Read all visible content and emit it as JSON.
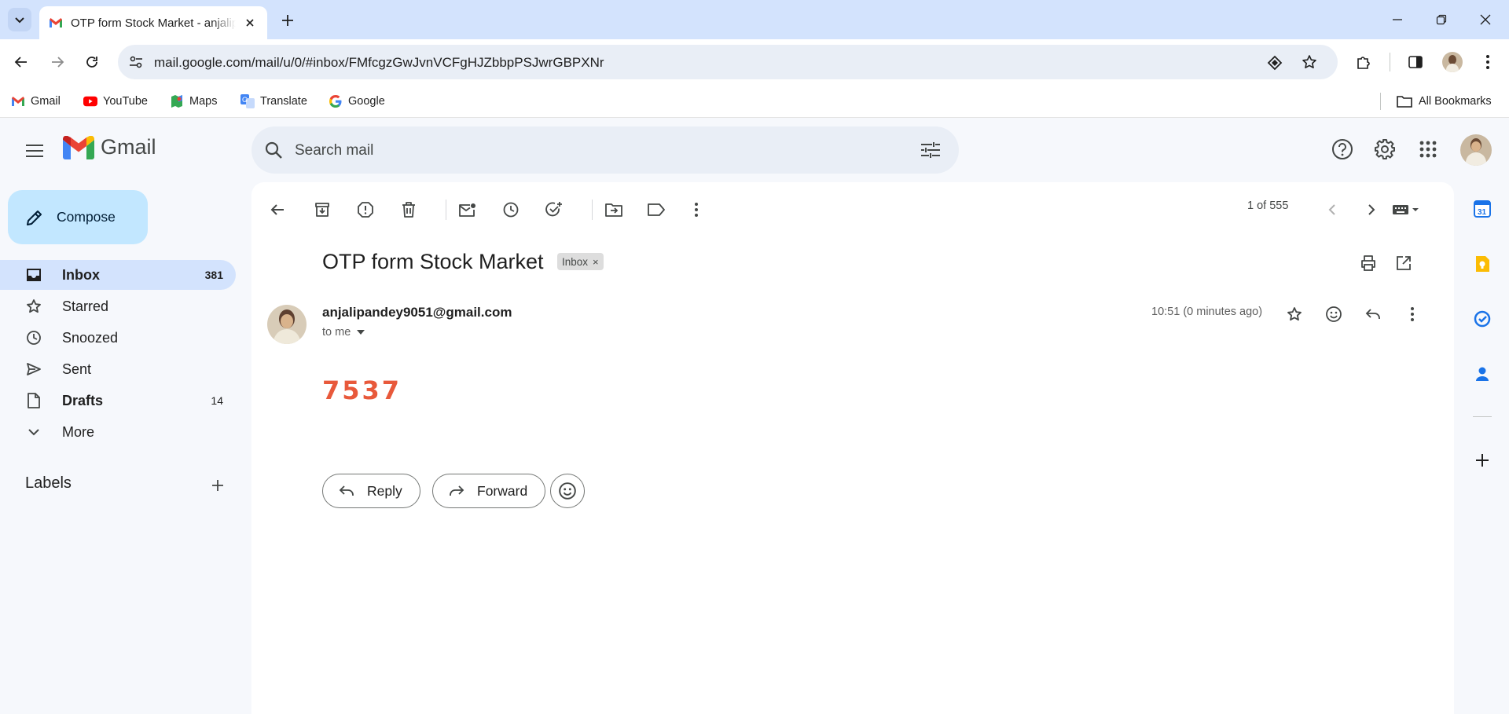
{
  "browser": {
    "tab_title": "OTP form Stock Market - anjalipandey9051@gmail.com - Gmail",
    "url": "mail.google.com/mail/u/0/#inbox/FMfcgzGwJvnVCFgHJZbbpPSJwrGBPXNr",
    "bookmarks": [
      "Gmail",
      "YouTube",
      "Maps",
      "Translate",
      "Google"
    ],
    "all_bookmarks": "All Bookmarks"
  },
  "gmail": {
    "brand": "Gmail",
    "search_placeholder": "Search mail",
    "compose": "Compose",
    "nav": [
      {
        "label": "Inbox",
        "count": "381",
        "icon": "inbox-icon"
      },
      {
        "label": "Starred",
        "count": "",
        "icon": "star-icon"
      },
      {
        "label": "Snoozed",
        "count": "",
        "icon": "clock-icon"
      },
      {
        "label": "Sent",
        "count": "",
        "icon": "send-icon"
      },
      {
        "label": "Drafts",
        "count": "14",
        "icon": "draft-icon"
      },
      {
        "label": "More",
        "count": "",
        "icon": "chevron-down-icon"
      }
    ],
    "labels_heading": "Labels"
  },
  "message": {
    "pager": "1 of 555",
    "subject": "OTP form Stock Market",
    "label_chip": "Inbox",
    "sender": "anjalipandey9051@gmail.com",
    "to": "to me",
    "time": "10:51 (0 minutes ago)",
    "body_code": "7537",
    "reply": "Reply",
    "forward": "Forward"
  },
  "colors": {
    "accent": "#d3e3fd",
    "compose": "#c2e7ff",
    "otp": "#e8593b",
    "background": "#f6f8fc"
  }
}
